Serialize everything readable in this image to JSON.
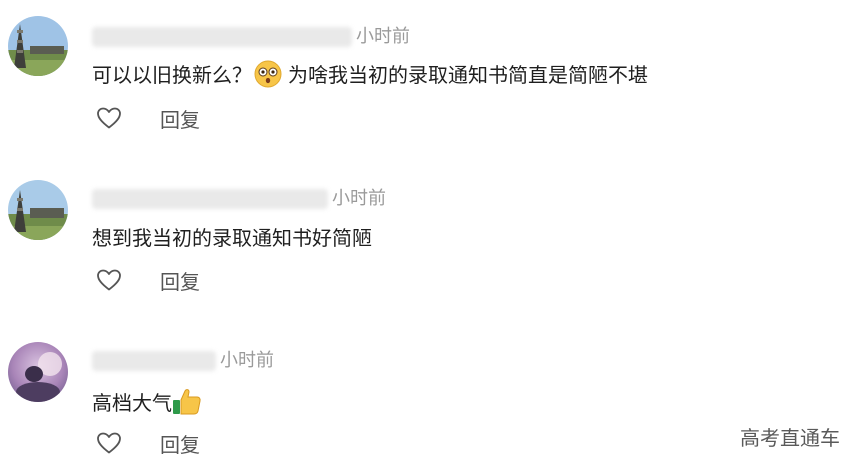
{
  "comments": [
    {
      "time_suffix": "小时前",
      "text_before": "可以以旧换新么？",
      "text_after": "为啥我当初的录取通知书简直是简陋不堪",
      "emoji": "astonished-face-emoji",
      "reply_label": "回复"
    },
    {
      "time_suffix": "小时前",
      "text_before": "想到我当初的录取通知书好简陋",
      "reply_label": "回复"
    },
    {
      "time_suffix": "小时前",
      "text_before": "高档大气",
      "emoji": "thumbs-up-emoji",
      "reply_label": "回复"
    }
  ],
  "icons": {
    "like": "heart-outline-icon"
  },
  "watermark": "高考直通车"
}
